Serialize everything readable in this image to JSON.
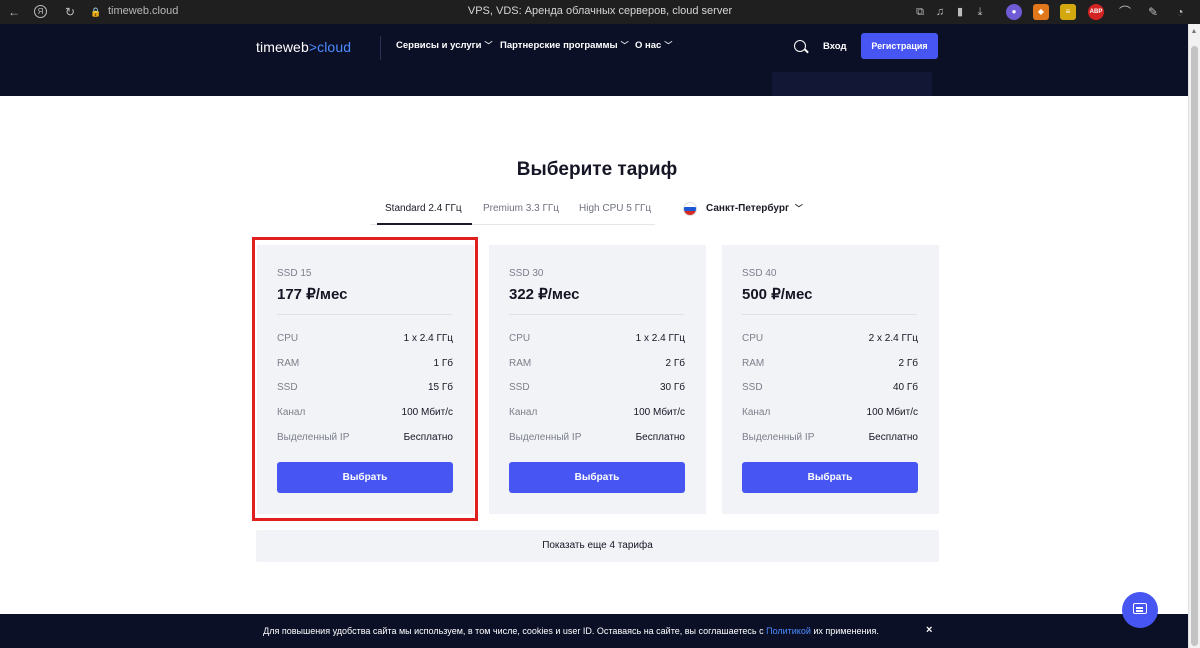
{
  "browser": {
    "url": "timeweb.cloud",
    "title": "VPS, VDS: Аренда облачных серверов, cloud server",
    "ext_abp": "ABP"
  },
  "header": {
    "logo_main": "timeweb",
    "logo_sep": ">",
    "logo_cloud": "cloud",
    "menu": [
      {
        "label": "Сервисы и услуги"
      },
      {
        "label": "Партнерские программы"
      },
      {
        "label": "О нас"
      }
    ],
    "login": "Вход",
    "register": "Регистрация"
  },
  "main": {
    "heading": "Выберите тариф",
    "tabs": [
      {
        "label": "Standard 2.4 ГГц",
        "active": true
      },
      {
        "label": "Premium 3.3 ГГц",
        "active": false
      },
      {
        "label": "High CPU 5 ГГц",
        "active": false
      }
    ],
    "city": "Санкт-Петербург",
    "plans": [
      {
        "name": "SSD 15",
        "price": "177 ₽/мес",
        "specs": [
          {
            "k": "CPU",
            "v": "1 x 2.4 ГГц"
          },
          {
            "k": "RAM",
            "v": "1 Гб"
          },
          {
            "k": "SSD",
            "v": "15 Гб"
          },
          {
            "k": "Канал",
            "v": "100 Мбит/с"
          },
          {
            "k": "Выделенный IP",
            "v": "Бесплатно"
          }
        ],
        "button": "Выбрать"
      },
      {
        "name": "SSD 30",
        "price": "322 ₽/мес",
        "specs": [
          {
            "k": "CPU",
            "v": "1 x 2.4 ГГц"
          },
          {
            "k": "RAM",
            "v": "2 Гб"
          },
          {
            "k": "SSD",
            "v": "30 Гб"
          },
          {
            "k": "Канал",
            "v": "100 Мбит/с"
          },
          {
            "k": "Выделенный IP",
            "v": "Бесплатно"
          }
        ],
        "button": "Выбрать"
      },
      {
        "name": "SSD 40",
        "price": "500 ₽/мес",
        "specs": [
          {
            "k": "CPU",
            "v": "2 x 2.4 ГГц"
          },
          {
            "k": "RAM",
            "v": "2 Гб"
          },
          {
            "k": "SSD",
            "v": "40 Гб"
          },
          {
            "k": "Канал",
            "v": "100 Мбит/с"
          },
          {
            "k": "Выделенный IP",
            "v": "Бесплатно"
          }
        ],
        "button": "Выбрать"
      }
    ],
    "show_more": "Показать еще 4 тарифа"
  },
  "cookie": {
    "text_before": "Для повышения удобства сайта мы используем, в том числе, cookies и user ID. Оставаясь на сайте, вы соглашаетесь с ",
    "link": "Политикой",
    "text_after": " их применения.",
    "close": "×"
  },
  "colors": {
    "accent": "#4756f3",
    "header_bg": "#0b1027",
    "card_bg": "#f2f3f6",
    "highlight": "#e0201f"
  }
}
